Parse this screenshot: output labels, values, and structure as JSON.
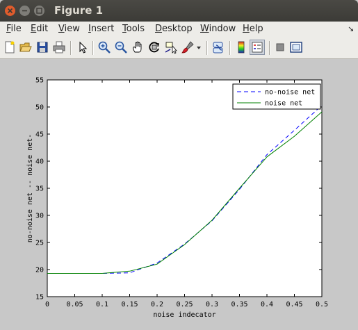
{
  "window": {
    "title": "Figure 1"
  },
  "menu": [
    {
      "label": "File",
      "ul": "F",
      "rest": "ile"
    },
    {
      "label": "Edit",
      "ul": "E",
      "rest": "dit"
    },
    {
      "label": "View",
      "ul": "V",
      "rest": "iew"
    },
    {
      "label": "Insert",
      "ul": "I",
      "rest": "nsert"
    },
    {
      "label": "Tools",
      "ul": "T",
      "rest": "ools"
    },
    {
      "label": "Desktop",
      "ul": "D",
      "rest": "esktop"
    },
    {
      "label": "Window",
      "ul": "W",
      "rest": "indow"
    },
    {
      "label": "Help",
      "ul": "H",
      "rest": "elp"
    }
  ],
  "toolbar": [
    "new-figure-icon",
    "open-file-icon",
    "save-icon",
    "print-icon",
    "edit-plot-arrow-icon",
    "zoom-in-icon",
    "zoom-out-icon",
    "pan-hand-icon",
    "rotate-3d-icon",
    "data-cursor-icon",
    "brush-icon",
    "brush-dropdown-icon",
    "link-plot-icon",
    "insert-colorbar-icon",
    "insert-legend-icon",
    "hide-plot-tools-icon",
    "show-plot-tools-icon"
  ],
  "chart_data": {
    "type": "line",
    "xlabel": "noise indecator",
    "ylabel": "no-noise net -- noise net-",
    "xlim": [
      0,
      0.5
    ],
    "ylim": [
      15,
      55
    ],
    "xticks": [
      "0",
      "0.05",
      "0.1",
      "0.15",
      "0.2",
      "0.25",
      "0.3",
      "0.35",
      "0.4",
      "0.45",
      "0.5"
    ],
    "yticks": [
      "15",
      "20",
      "25",
      "30",
      "35",
      "40",
      "45",
      "50",
      "55"
    ],
    "legend_position": "top-right",
    "series": [
      {
        "name": "no-noise net",
        "color": "#0000ff",
        "dash": "dashed",
        "x": [
          0,
          0.05,
          0.1,
          0.15,
          0.2,
          0.25,
          0.3,
          0.35,
          0.4,
          0.45,
          0.5
        ],
        "y": [
          19.3,
          19.3,
          19.3,
          19.4,
          21.2,
          24.7,
          29.0,
          34.8,
          41.2,
          45.7,
          50.3
        ]
      },
      {
        "name": "noise net",
        "color": "#008000",
        "dash": "solid",
        "x": [
          0,
          0.05,
          0.1,
          0.15,
          0.2,
          0.25,
          0.3,
          0.35,
          0.4,
          0.45,
          0.5
        ],
        "y": [
          19.3,
          19.3,
          19.3,
          19.7,
          21.0,
          24.6,
          29.1,
          35.0,
          40.8,
          44.6,
          49.1
        ]
      }
    ]
  }
}
